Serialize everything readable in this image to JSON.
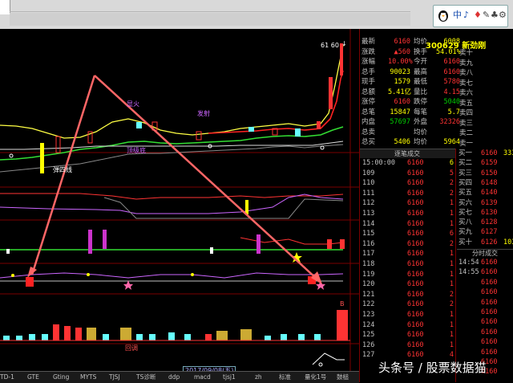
{
  "qq_panel": {
    "icon": "penguin-icon",
    "labels": [
      "中",
      "♪",
      "♦",
      "✎",
      "♣",
      "⚙"
    ]
  },
  "stock": {
    "code": "300629",
    "name": "新劲刚"
  },
  "quote_rows": [
    {
      "label": "最新",
      "value": "6160",
      "label2": "均价",
      "value2": "6008",
      "color": "#ff3333",
      "color2": "#ffff00"
    },
    {
      "label": "涨跌",
      "value": "▲560",
      "label2": "换手",
      "value2": "54.01%",
      "color": "#ff3333",
      "color2": "#ffff00"
    },
    {
      "label": "涨幅",
      "value": "10.00%",
      "label2": "今开",
      "value2": "6160",
      "color": "#ff3333",
      "color2": "#ff3333"
    },
    {
      "label": "总手",
      "value": "90023",
      "label2": "最高",
      "value2": "6160",
      "color": "#ffff00",
      "color2": "#ff3333"
    },
    {
      "label": "现手",
      "value": "1579",
      "label2": "最低",
      "value2": "5780",
      "color": "#ffff00",
      "color2": "#ff3333"
    },
    {
      "label": "总额",
      "value": "5.41亿",
      "label2": "量比",
      "value2": "4.15",
      "color": "#ffff00",
      "color2": "#ff3333"
    },
    {
      "label": "涨停",
      "value": "6160",
      "label2": "跌停",
      "value2": "5040",
      "color": "#ff3333",
      "color2": "#00cc00"
    },
    {
      "label": "总笔",
      "value": "15847",
      "label2": "每笔",
      "value2": "5.7",
      "color": "#ffff00",
      "color2": "#ffff00"
    },
    {
      "label": "内盘",
      "value": "57697",
      "label2": "外盘",
      "value2": "32326",
      "color": "#00cc00",
      "color2": "#ff3333"
    },
    {
      "label": "总卖",
      "value": "",
      "label2": "均价",
      "value2": "",
      "color": "#ffff00",
      "color2": "#ffff00"
    },
    {
      "label": "总买",
      "value": "5406",
      "label2": "均价",
      "value2": "5964",
      "color": "#ffff00",
      "color2": "#ffff00"
    }
  ],
  "sell_labels": [
    "卖十",
    "卖九",
    "卖八",
    "卖七",
    "卖六",
    "卖五",
    "卖四",
    "卖三",
    "卖二",
    "卖一"
  ],
  "tick_header": "逐笔成交",
  "ticks": [
    {
      "time": "15:00:00",
      "mark": "",
      "price": "6160",
      "vol": "6"
    },
    {
      "time": "109",
      "mark": "",
      "price": "6160",
      "vol": "5"
    },
    {
      "time": "110",
      "mark": "",
      "price": "6160",
      "vol": "2"
    },
    {
      "time": "111",
      "mark": "",
      "price": "6160",
      "vol": "2"
    },
    {
      "time": "112",
      "mark": "",
      "price": "6160",
      "vol": "1"
    },
    {
      "time": "113",
      "mark": "",
      "price": "6160",
      "vol": "1"
    },
    {
      "time": "114",
      "mark": "",
      "price": "6160",
      "vol": "1"
    },
    {
      "time": "115",
      "mark": "",
      "price": "6160",
      "vol": "6"
    },
    {
      "time": "116",
      "mark": "",
      "price": "6160",
      "vol": "2"
    },
    {
      "time": "117",
      "mark": "",
      "price": "6160",
      "vol": "1"
    },
    {
      "time": "118",
      "mark": "",
      "price": "6160",
      "vol": "1"
    },
    {
      "time": "119",
      "mark": "",
      "price": "6160",
      "vol": "1"
    },
    {
      "time": "120",
      "mark": "",
      "price": "6160",
      "vol": "1"
    },
    {
      "time": "121",
      "mark": "",
      "price": "6160",
      "vol": "2"
    },
    {
      "time": "122",
      "mark": "",
      "price": "6160",
      "vol": "2"
    },
    {
      "time": "123",
      "mark": "",
      "price": "6160",
      "vol": "1"
    },
    {
      "time": "124",
      "mark": "",
      "price": "6160",
      "vol": "1"
    },
    {
      "time": "125",
      "mark": "",
      "price": "6160",
      "vol": "1"
    },
    {
      "time": "126",
      "mark": "",
      "price": "6160",
      "vol": "1"
    },
    {
      "time": "127",
      "mark": "",
      "price": "6160",
      "vol": "4"
    }
  ],
  "orders": [
    {
      "label": "买一",
      "price": "6160",
      "vol": "333"
    },
    {
      "label": "买二",
      "price": "6159",
      "vol": ""
    },
    {
      "label": "买三",
      "price": "6150",
      "vol": ""
    },
    {
      "label": "买四",
      "price": "6148",
      "vol": ""
    },
    {
      "label": "买五",
      "price": "6140",
      "vol": ""
    },
    {
      "label": "买六",
      "price": "6139",
      "vol": ""
    },
    {
      "label": "买七",
      "price": "6130",
      "vol": ""
    },
    {
      "label": "买八",
      "price": "6128",
      "vol": ""
    },
    {
      "label": "买九",
      "price": "6127",
      "vol": ""
    },
    {
      "label": "买十",
      "price": "6126",
      "vol": "103"
    }
  ],
  "fen_header": "分时成交",
  "fen_rows": [
    {
      "time": "14:54",
      "price": "6160"
    },
    {
      "time": "14:55",
      "price": "6160"
    },
    {
      "time": "",
      "price": "6160"
    },
    {
      "time": "",
      "price": "6160"
    },
    {
      "time": "",
      "price": "6160"
    },
    {
      "time": "",
      "price": "6160"
    },
    {
      "time": "",
      "price": "6160"
    },
    {
      "time": "",
      "price": "6160"
    },
    {
      "time": "",
      "price": "6160"
    },
    {
      "time": "",
      "price": "6160"
    },
    {
      "time": "",
      "price": "6160"
    },
    {
      "time": "",
      "price": "6160"
    }
  ],
  "chart_labels": {
    "top_value": "61 60",
    "upper_right_mark": "↓",
    "purple_1": "显火",
    "purple_2": "发射",
    "purple_3": "顶级底",
    "white_1": "弹四线",
    "date": "2017/09/08(五)",
    "red_b": "B",
    "red_bottom": "回调"
  },
  "tabs": [
    "TD-1",
    "GTE",
    "Gting",
    "MYTS",
    "TJSJ",
    "TS诊断",
    "ddp",
    "macd",
    "tjsj1",
    "zh",
    "标准",
    "量化1号",
    "鼓槌"
  ],
  "watermark": "头条号 / 股票数据猫",
  "colors": {
    "up": "#ff3333",
    "down": "#00cc00",
    "value": "#ffff00",
    "label": "#c0c0c0",
    "cyan": "#66ffff",
    "magenta": "#cc33cc"
  }
}
